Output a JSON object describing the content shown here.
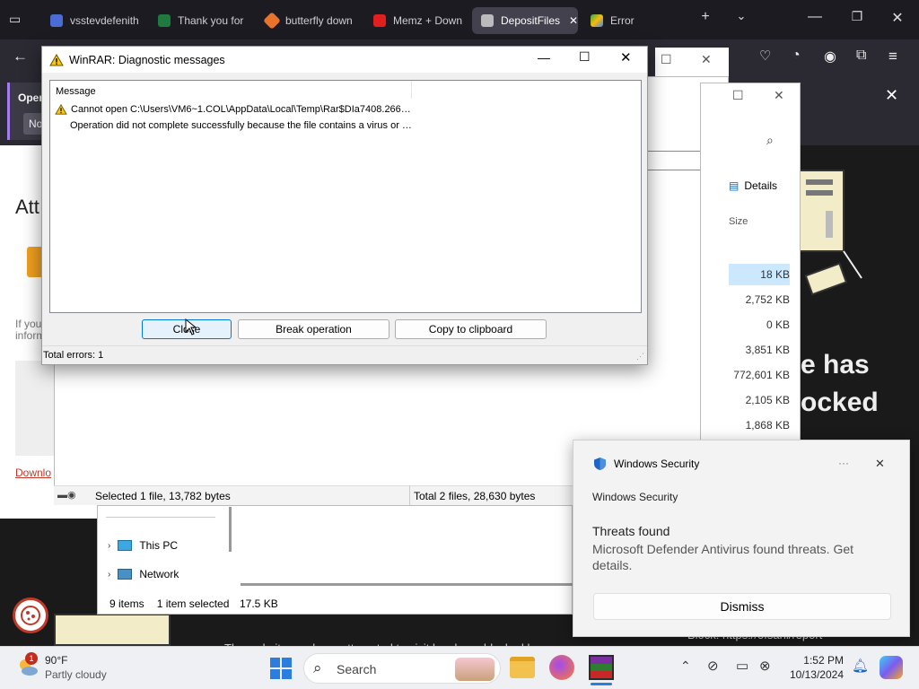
{
  "browser": {
    "tabs": [
      {
        "label": "vsstevdefenith",
        "color": "#4a6cd4"
      },
      {
        "label": "Thank you for",
        "color": "#1f7a3f"
      },
      {
        "label": "butterfly down",
        "color": "#e8732a"
      },
      {
        "label": "Memz + Down",
        "color": "#e21f1f"
      },
      {
        "label": "DepositFiles",
        "color": "#bbbbbb"
      },
      {
        "label": "Error",
        "color": "#34a853"
      }
    ],
    "active_tab_index": 4
  },
  "webpage": {
    "att_partial": "Att",
    "if_you_partial": "If you",
    "inform_partial": "inform",
    "download_partial": "Downlo",
    "big_text_line1": "e has",
    "big_text_line2": "ocked",
    "footer_text": "Block: https://ofsahl/report",
    "footer_text_left": "The website you have attempted to visit has been blocked by"
  },
  "infobar": {
    "open_partial": "Oper",
    "no_partial": "No"
  },
  "explorer": {
    "details_label": "Details",
    "size_header": "Size",
    "sizes": [
      "18 KB",
      "2,752 KB",
      "0 KB",
      "3,851 KB",
      "772,601 KB",
      "2,105 KB",
      "1,868 KB"
    ],
    "status_selected": "Selected 1 file, 13,782 bytes",
    "status_total": "Total 2 files, 28,630 bytes",
    "nav_items": [
      "This PC",
      "Network"
    ],
    "footer_items": "9 items",
    "footer_selected": "1 item selected",
    "footer_size": "17.5 KB"
  },
  "dialog": {
    "title": "WinRAR: Diagnostic messages",
    "column_header": "Message",
    "line1": "Cannot open C:\\Users\\VM6~1.COL\\AppData\\Local\\Temp\\Rar$DIa7408.266…",
    "line2": "Operation did not complete successfully because the file contains a virus or …",
    "buttons": {
      "close": "Close",
      "break": "Break operation",
      "copy": "Copy to clipboard"
    },
    "status": "Total errors: 1"
  },
  "toast": {
    "app_name": "Windows Security",
    "subtitle": "Windows Security",
    "heading": "Threats found",
    "body": "Microsoft Defender Antivirus found threats. Get details.",
    "dismiss": "Dismiss",
    "more": "···",
    "close": "✕"
  },
  "taskbar": {
    "weather_temp": "90°F",
    "weather_desc": "Partly cloudy",
    "weather_badge": "1",
    "search_label": "Search",
    "time": "1:52 PM",
    "date": "10/13/2024"
  }
}
